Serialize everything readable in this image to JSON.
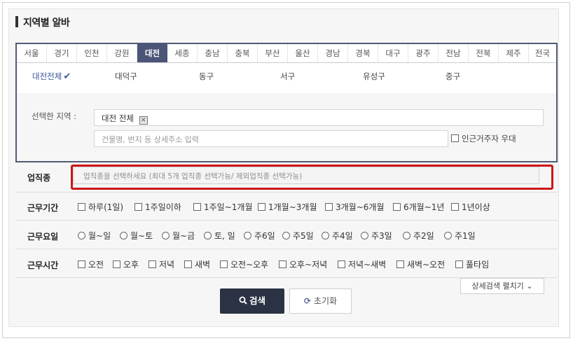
{
  "title": "지역별 알바",
  "region_tabs": [
    "서울",
    "경기",
    "인천",
    "강원",
    "대전",
    "세종",
    "충남",
    "충북",
    "부산",
    "울산",
    "경남",
    "경북",
    "대구",
    "광주",
    "전남",
    "전북",
    "제주",
    "전국"
  ],
  "active_region": "대전",
  "districts": [
    "대전전체",
    "대덕구",
    "동구",
    "서구",
    "유성구",
    "중구"
  ],
  "active_district": "대전전체",
  "selection": {
    "label": "선택한 지역 :",
    "selected_tag": "대전 전체",
    "address_placeholder": "건물명, 번지 등 상세주소 입력",
    "nearby_label": "인근거주자 우대"
  },
  "job_type": {
    "label": "업직종",
    "placeholder": "업직종을 선택하세요 (최대 5개 업직종 선택가능/ 제외업직종 선택가능)"
  },
  "work_period": {
    "label": "근무기간",
    "options": [
      "하루(1일)",
      "1주일이하",
      "1주일~1개월",
      "1개월~3개월",
      "3개월~6개월",
      "6개월~1년",
      "1년이상"
    ]
  },
  "work_days": {
    "label": "근무요일",
    "options": [
      "월~일",
      "월~토",
      "월~금",
      "토, 일",
      "주6일",
      "주5일",
      "주4일",
      "주3일",
      "주2일",
      "주1일"
    ]
  },
  "work_hours": {
    "label": "근무시간",
    "options": [
      "오전",
      "오후",
      "저녁",
      "새벽",
      "오전~오후",
      "오후~저녁",
      "저녁~새벽",
      "새벽~오전",
      "풀타임"
    ]
  },
  "buttons": {
    "advanced": "상세검색 펼치기",
    "search": "검색",
    "reset": "초기화"
  },
  "colors": {
    "active_tab": "#4a5577",
    "highlight_border": "#cc1518",
    "search_button": "#2b3243"
  }
}
